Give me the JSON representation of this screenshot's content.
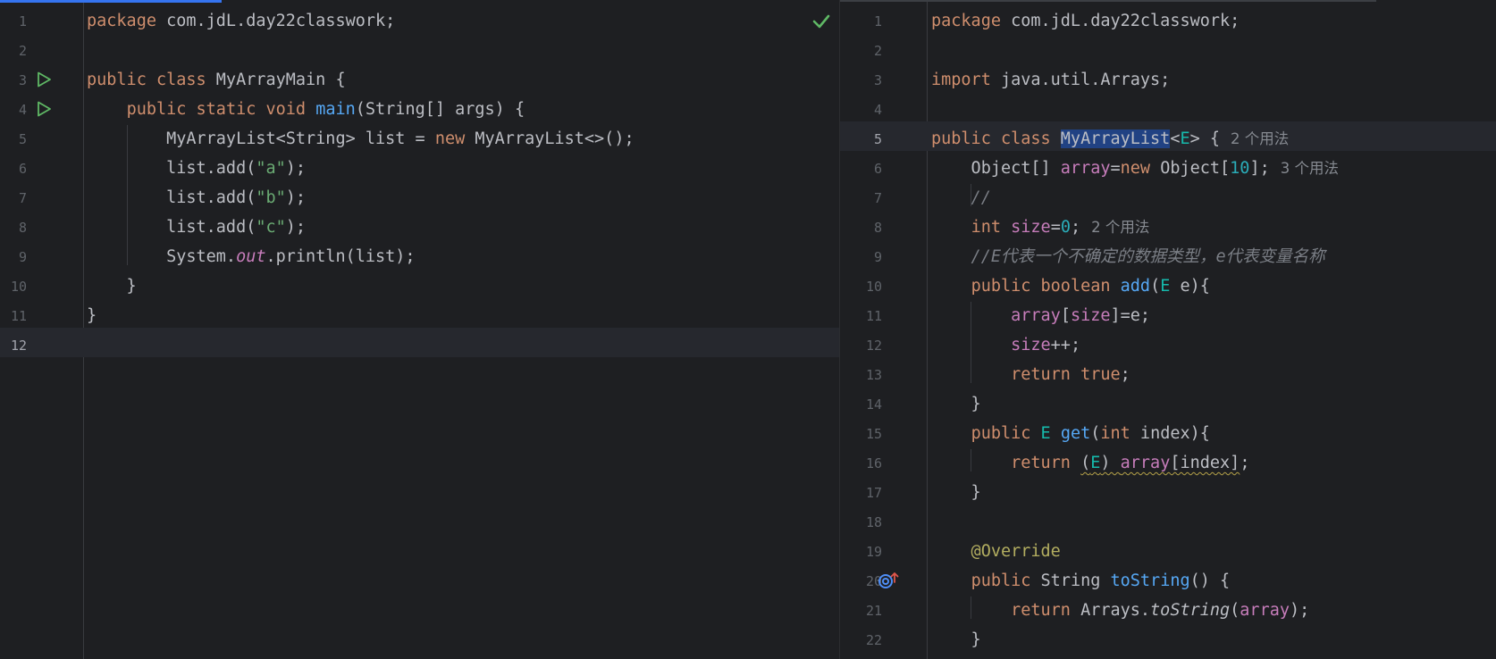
{
  "left_editor": {
    "file": "MyArrayMain",
    "status_icon": "check-icon",
    "lines": [
      {
        "n": "1",
        "tokens": [
          [
            "kw",
            "package"
          ],
          [
            "plain",
            " com.jdL.day22classwork;"
          ]
        ]
      },
      {
        "n": "2",
        "tokens": []
      },
      {
        "n": "3",
        "icon": "run-icon",
        "tokens": [
          [
            "kw",
            "public class"
          ],
          [
            "plain",
            " MyArrayMain {"
          ]
        ]
      },
      {
        "n": "4",
        "icon": "run-icon",
        "tokens": [
          [
            "plain",
            "    "
          ],
          [
            "kw",
            "public static void"
          ],
          [
            "plain",
            " "
          ],
          [
            "fn",
            "main"
          ],
          [
            "plain",
            "(String[] args) {"
          ]
        ]
      },
      {
        "n": "5",
        "tokens": [
          [
            "plain",
            "        MyArrayList<String> list = "
          ],
          [
            "kw",
            "new"
          ],
          [
            "plain",
            " MyArrayList<>();"
          ]
        ]
      },
      {
        "n": "6",
        "tokens": [
          [
            "plain",
            "        list.add("
          ],
          [
            "str",
            "\"a\""
          ],
          [
            "plain",
            ");"
          ]
        ]
      },
      {
        "n": "7",
        "tokens": [
          [
            "plain",
            "        list.add("
          ],
          [
            "str",
            "\"b\""
          ],
          [
            "plain",
            ");"
          ]
        ]
      },
      {
        "n": "8",
        "tokens": [
          [
            "plain",
            "        list.add("
          ],
          [
            "str",
            "\"c\""
          ],
          [
            "plain",
            ");"
          ]
        ]
      },
      {
        "n": "9",
        "tokens": [
          [
            "plain",
            "        System."
          ],
          [
            "italic-field",
            "out"
          ],
          [
            "plain",
            ".println(list);"
          ]
        ]
      },
      {
        "n": "10",
        "tokens": [
          [
            "plain",
            "    }"
          ]
        ]
      },
      {
        "n": "11",
        "tokens": [
          [
            "plain",
            "}"
          ]
        ]
      },
      {
        "n": "12",
        "current": true,
        "tokens": []
      }
    ]
  },
  "right_editor": {
    "file": "MyArrayList",
    "lines": [
      {
        "n": "1",
        "tokens": [
          [
            "kw",
            "package"
          ],
          [
            "plain",
            " com.jdL.day22classwork;"
          ]
        ]
      },
      {
        "n": "2",
        "tokens": []
      },
      {
        "n": "3",
        "tokens": [
          [
            "kw",
            "import"
          ],
          [
            "plain",
            " java.util.Arrays;"
          ]
        ]
      },
      {
        "n": "4",
        "tokens": []
      },
      {
        "n": "5",
        "current": true,
        "tokens": [
          [
            "kw",
            "public class"
          ],
          [
            "plain",
            " "
          ],
          [
            "selected-word",
            "MyArrayList"
          ],
          [
            "plain",
            "<"
          ],
          [
            "tparam",
            "E"
          ],
          [
            "plain",
            "> {"
          ],
          [
            "hint",
            "2 个用法"
          ]
        ]
      },
      {
        "n": "6",
        "tokens": [
          [
            "plain",
            "    Object[] "
          ],
          [
            "field",
            "array"
          ],
          [
            "plain",
            "="
          ],
          [
            "kw",
            "new"
          ],
          [
            "plain",
            " Object["
          ],
          [
            "num",
            "10"
          ],
          [
            "plain",
            "];"
          ],
          [
            "hint",
            "3 个用法"
          ]
        ]
      },
      {
        "n": "7",
        "tokens": [
          [
            "cmt",
            "    //"
          ]
        ]
      },
      {
        "n": "8",
        "tokens": [
          [
            "plain",
            "    "
          ],
          [
            "kw",
            "int"
          ],
          [
            "plain",
            " "
          ],
          [
            "field",
            "size"
          ],
          [
            "plain",
            "="
          ],
          [
            "num",
            "0"
          ],
          [
            "plain",
            ";"
          ],
          [
            "hint",
            "2 个用法"
          ]
        ]
      },
      {
        "n": "9",
        "tokens": [
          [
            "cmt",
            "    //E代表一个不确定的数据类型，e代表变量名称"
          ]
        ]
      },
      {
        "n": "10",
        "tokens": [
          [
            "plain",
            "    "
          ],
          [
            "kw",
            "public boolean"
          ],
          [
            "plain",
            " "
          ],
          [
            "fn",
            "add"
          ],
          [
            "plain",
            "("
          ],
          [
            "tparam",
            "E"
          ],
          [
            "plain",
            " e){"
          ]
        ]
      },
      {
        "n": "11",
        "tokens": [
          [
            "plain",
            "        "
          ],
          [
            "field",
            "array"
          ],
          [
            "plain",
            "["
          ],
          [
            "field",
            "size"
          ],
          [
            "plain",
            "]=e;"
          ]
        ]
      },
      {
        "n": "12",
        "tokens": [
          [
            "plain",
            "        "
          ],
          [
            "field",
            "size"
          ],
          [
            "plain",
            "++;"
          ]
        ]
      },
      {
        "n": "13",
        "tokens": [
          [
            "plain",
            "        "
          ],
          [
            "kw",
            "return true"
          ],
          [
            "plain",
            ";"
          ]
        ]
      },
      {
        "n": "14",
        "tokens": [
          [
            "plain",
            "    }"
          ]
        ]
      },
      {
        "n": "15",
        "tokens": [
          [
            "plain",
            "    "
          ],
          [
            "kw",
            "public"
          ],
          [
            "plain",
            " "
          ],
          [
            "tparam",
            "E"
          ],
          [
            "plain",
            " "
          ],
          [
            "fn",
            "get"
          ],
          [
            "plain",
            "("
          ],
          [
            "kw",
            "int"
          ],
          [
            "plain",
            " index){"
          ]
        ]
      },
      {
        "n": "16",
        "tokens": [
          [
            "plain",
            "        "
          ],
          [
            "kw",
            "return"
          ],
          [
            "plain",
            " "
          ],
          [
            "warn-start",
            "("
          ],
          [
            "warn-tparam",
            "E"
          ],
          [
            "warn",
            ") "
          ],
          [
            "warn-field",
            "array"
          ],
          [
            "warn",
            "[index]"
          ],
          [
            "plain",
            ";"
          ]
        ]
      },
      {
        "n": "17",
        "tokens": [
          [
            "plain",
            "    }"
          ]
        ]
      },
      {
        "n": "18",
        "tokens": []
      },
      {
        "n": "19",
        "tokens": [
          [
            "anno",
            "    @Override"
          ]
        ]
      },
      {
        "n": "20",
        "icon": "override-icon",
        "tokens": [
          [
            "plain",
            "    "
          ],
          [
            "kw",
            "public"
          ],
          [
            "plain",
            " String "
          ],
          [
            "fn",
            "toString"
          ],
          [
            "plain",
            "() {"
          ]
        ]
      },
      {
        "n": "21",
        "tokens": [
          [
            "plain",
            "        "
          ],
          [
            "kw",
            "return"
          ],
          [
            "plain",
            " Arrays."
          ],
          [
            "static-call",
            "toString"
          ],
          [
            "plain",
            "("
          ],
          [
            "field",
            "array"
          ],
          [
            "plain",
            ");"
          ]
        ]
      },
      {
        "n": "22",
        "tokens": [
          [
            "plain",
            "    }"
          ]
        ]
      }
    ]
  },
  "colors": {
    "background": "#1e1f22",
    "keyword": "#cf8e6d",
    "string": "#6aab73",
    "number": "#2aacb8",
    "function": "#56a8f5",
    "field": "#c77dbb",
    "type_param": "#16baac",
    "comment": "#7a7e85",
    "annotation": "#b3ae60",
    "run_icon": "#5fb865",
    "check_icon": "#5fb865",
    "accent": "#3574f0"
  }
}
